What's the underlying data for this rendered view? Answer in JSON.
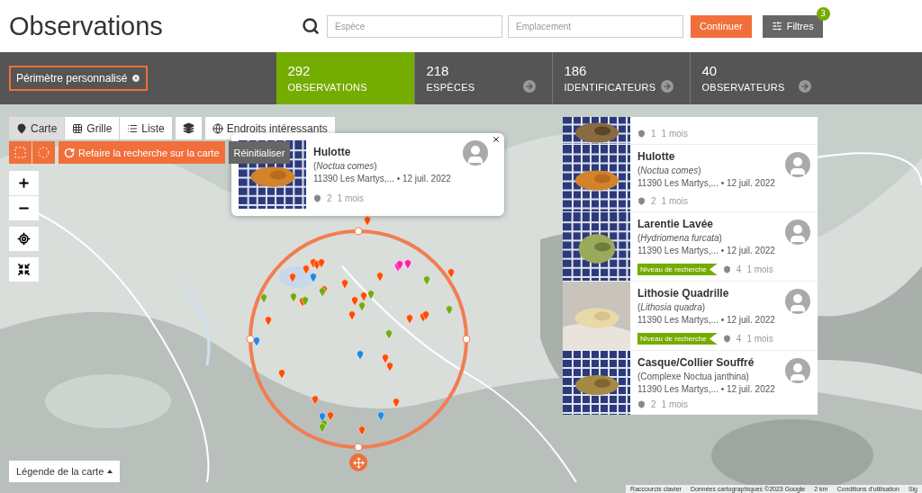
{
  "header": {
    "title": "Observations",
    "species_field": {
      "placeholder": "Espèce"
    },
    "location_field": {
      "placeholder": "Emplacement"
    },
    "submit": "Continuer",
    "filters": {
      "label": "Filtres",
      "count": "3"
    }
  },
  "scope": {
    "label": "Périmètre personnalisé"
  },
  "stats": [
    {
      "value": "292",
      "label": "OBSERVATIONS",
      "selected": true
    },
    {
      "value": "218",
      "label": "ESPÈCES",
      "selected": false
    },
    {
      "value": "186",
      "label": "IDENTIFICATEURS",
      "selected": false
    },
    {
      "value": "40",
      "label": "OBSERVATEURS",
      "selected": false
    }
  ],
  "view_tabs": [
    {
      "label": "Carte",
      "selected": true
    },
    {
      "label": "Grille",
      "selected": false
    },
    {
      "label": "Liste",
      "selected": false
    }
  ],
  "places_button": "Endroits intéressants",
  "redo_search": "Refaire la recherche sur la carte",
  "reset": "Réinitialiser",
  "popup": {
    "title": "Hulotte",
    "scientific": "(*Noctua comes*)",
    "place": "11390 Les Martys,...",
    "date": "• 12 juil. 2022",
    "ids": "2",
    "time": "1 mois"
  },
  "observations": [
    {
      "ids": "1",
      "time": "1 mois"
    },
    {
      "title": "Hulotte",
      "scientific": "(*Noctua comes*)",
      "place": "11390 Les Martys,...",
      "date": "• 12 juil. 2022",
      "ids": "2",
      "time": "1 mois"
    },
    {
      "title": "Larentie Lavée",
      "scientific": "(*Hydriomena furcata*)",
      "place": "11390 Les Martys,...",
      "date": "• 12 juil. 2022",
      "badge": "Niveau de recherche",
      "ids": "4",
      "time": "1 mois"
    },
    {
      "title": "Lithosie Quadrille",
      "scientific": "(*Lithosia quadra*)",
      "place": "11390 Les Martys,...",
      "date": "• 12 juil. 2022",
      "badge": "Niveau de recherche",
      "ids": "4",
      "time": "1 mois"
    },
    {
      "title": "Casque/Collier Souffré",
      "scientific": "(Complexe Noctua janthina)",
      "place": "11390 Les Martys,...",
      "date": "• 12 juil. 2022",
      "ids": "2",
      "time": "1 mois"
    }
  ],
  "legend_button": "Légende de la carte",
  "attribution": [
    "Raccourcis clavier",
    "Données cartographiques ©2023 Google",
    "2 km",
    "Conditions d'utilisation",
    "Sig"
  ]
}
